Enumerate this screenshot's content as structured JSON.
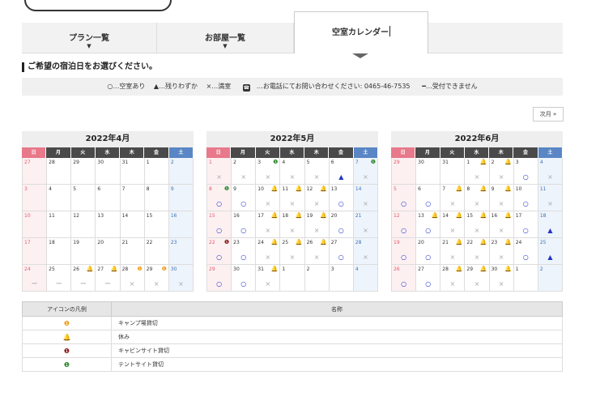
{
  "tabs": [
    {
      "label": "プラン一覧",
      "caret": "▼"
    },
    {
      "label": "お部屋一覧",
      "caret": "▼"
    },
    {
      "label": "空室カレンダー"
    }
  ],
  "heading": "ご希望の宿泊日をお選びください。",
  "legend_bar": {
    "available": "○…空室あり",
    "few": "▲…残りわずか",
    "full": "×…満室",
    "phone_icon": "☎",
    "phone": "…お電話にてお問い合わせください: 0465-46-7535",
    "closed": "━…受付できません"
  },
  "next_button": "次月 »",
  "weekdays": [
    "日",
    "月",
    "火",
    "水",
    "木",
    "金",
    "土"
  ],
  "calendars": [
    {
      "title": "2022年4月",
      "weeks": [
        [
          {
            "d": "27",
            "s": ""
          },
          {
            "d": "28",
            "s": ""
          },
          {
            "d": "29",
            "s": ""
          },
          {
            "d": "30",
            "s": ""
          },
          {
            "d": "31",
            "s": ""
          },
          {
            "d": "1",
            "s": ""
          },
          {
            "d": "2",
            "s": ""
          }
        ],
        [
          {
            "d": "3",
            "s": ""
          },
          {
            "d": "4",
            "s": ""
          },
          {
            "d": "5",
            "s": ""
          },
          {
            "d": "6",
            "s": ""
          },
          {
            "d": "7",
            "s": ""
          },
          {
            "d": "8",
            "s": ""
          },
          {
            "d": "9",
            "s": ""
          }
        ],
        [
          {
            "d": "10",
            "s": ""
          },
          {
            "d": "11",
            "s": ""
          },
          {
            "d": "12",
            "s": ""
          },
          {
            "d": "13",
            "s": ""
          },
          {
            "d": "14",
            "s": ""
          },
          {
            "d": "15",
            "s": ""
          },
          {
            "d": "16",
            "s": ""
          }
        ],
        [
          {
            "d": "17",
            "s": ""
          },
          {
            "d": "18",
            "s": ""
          },
          {
            "d": "19",
            "s": ""
          },
          {
            "d": "20",
            "s": ""
          },
          {
            "d": "21",
            "s": ""
          },
          {
            "d": "22",
            "s": ""
          },
          {
            "d": "23",
            "s": ""
          }
        ],
        [
          {
            "d": "24",
            "s": "ー"
          },
          {
            "d": "25",
            "s": "ー"
          },
          {
            "d": "26",
            "s": "ー",
            "i": "bell"
          },
          {
            "d": "27",
            "s": "ー",
            "i": "bell"
          },
          {
            "d": "28",
            "s": "×",
            "i": "camp"
          },
          {
            "d": "29",
            "s": "×",
            "i": "camp"
          },
          {
            "d": "30",
            "s": "×"
          }
        ]
      ]
    },
    {
      "title": "2022年5月",
      "weeks": [
        [
          {
            "d": "1",
            "s": "×"
          },
          {
            "d": "2",
            "s": "×"
          },
          {
            "d": "3",
            "s": "×",
            "i": "tent"
          },
          {
            "d": "4",
            "s": "×"
          },
          {
            "d": "5",
            "s": "×"
          },
          {
            "d": "6",
            "s": "▲"
          },
          {
            "d": "7",
            "s": "×",
            "i": "tent"
          }
        ],
        [
          {
            "d": "8",
            "s": "○",
            "i": "tent"
          },
          {
            "d": "9",
            "s": "○"
          },
          {
            "d": "10",
            "s": "×",
            "i": "bell"
          },
          {
            "d": "11",
            "s": "×",
            "i": "bell"
          },
          {
            "d": "12",
            "s": "×",
            "i": "bell"
          },
          {
            "d": "13",
            "s": "○"
          },
          {
            "d": "14",
            "s": "×"
          }
        ],
        [
          {
            "d": "15",
            "s": "○"
          },
          {
            "d": "16",
            "s": "○"
          },
          {
            "d": "17",
            "s": "×",
            "i": "bell"
          },
          {
            "d": "18",
            "s": "×",
            "i": "bell"
          },
          {
            "d": "19",
            "s": "×",
            "i": "bell"
          },
          {
            "d": "20",
            "s": "○"
          },
          {
            "d": "21",
            "s": "×"
          }
        ],
        [
          {
            "d": "22",
            "s": "○",
            "i": "cabin"
          },
          {
            "d": "23",
            "s": "○"
          },
          {
            "d": "24",
            "s": "×",
            "i": "bell"
          },
          {
            "d": "25",
            "s": "×",
            "i": "bell"
          },
          {
            "d": "26",
            "s": "×",
            "i": "bell"
          },
          {
            "d": "27",
            "s": "○"
          },
          {
            "d": "28",
            "s": "×"
          }
        ],
        [
          {
            "d": "29",
            "s": "○"
          },
          {
            "d": "30",
            "s": "○"
          },
          {
            "d": "31",
            "s": "×",
            "i": "bell"
          },
          {
            "d": "1",
            "s": ""
          },
          {
            "d": "2",
            "s": ""
          },
          {
            "d": "3",
            "s": ""
          },
          {
            "d": "4",
            "s": ""
          }
        ]
      ]
    },
    {
      "title": "2022年6月",
      "weeks": [
        [
          {
            "d": "29",
            "s": ""
          },
          {
            "d": "30",
            "s": ""
          },
          {
            "d": "31",
            "s": ""
          },
          {
            "d": "1",
            "s": "×",
            "i": "bell"
          },
          {
            "d": "2",
            "s": "×",
            "i": "bell"
          },
          {
            "d": "3",
            "s": "○"
          },
          {
            "d": "4",
            "s": "×"
          }
        ],
        [
          {
            "d": "5",
            "s": "○"
          },
          {
            "d": "6",
            "s": "○"
          },
          {
            "d": "7",
            "s": "×",
            "i": "bell"
          },
          {
            "d": "8",
            "s": "×",
            "i": "bell"
          },
          {
            "d": "9",
            "s": "×",
            "i": "bell"
          },
          {
            "d": "10",
            "s": "○"
          },
          {
            "d": "11",
            "s": "×"
          }
        ],
        [
          {
            "d": "12",
            "s": "○"
          },
          {
            "d": "13",
            "s": "○",
            "i": "bell"
          },
          {
            "d": "14",
            "s": "×",
            "i": "bell"
          },
          {
            "d": "15",
            "s": "×",
            "i": "bell"
          },
          {
            "d": "16",
            "s": "×",
            "i": "bell"
          },
          {
            "d": "17",
            "s": "○"
          },
          {
            "d": "18",
            "s": "▲"
          }
        ],
        [
          {
            "d": "19",
            "s": "○"
          },
          {
            "d": "20",
            "s": "○"
          },
          {
            "d": "21",
            "s": "×",
            "i": "bell"
          },
          {
            "d": "22",
            "s": "×",
            "i": "bell"
          },
          {
            "d": "23",
            "s": "×",
            "i": "bell"
          },
          {
            "d": "24",
            "s": "○"
          },
          {
            "d": "25",
            "s": "▲"
          }
        ],
        [
          {
            "d": "26",
            "s": "○"
          },
          {
            "d": "27",
            "s": "○"
          },
          {
            "d": "28",
            "s": "×",
            "i": "bell"
          },
          {
            "d": "29",
            "s": "×",
            "i": "bell"
          },
          {
            "d": "30",
            "s": "×",
            "i": "bell"
          },
          {
            "d": "1",
            "s": ""
          },
          {
            "d": "2",
            "s": ""
          }
        ]
      ]
    }
  ],
  "legend_table": {
    "header_icon": "アイコンの凡例",
    "header_name": "名称",
    "rows": [
      {
        "icon": "camp",
        "name": "キャンプ場貸切"
      },
      {
        "icon": "bell",
        "name": "休み"
      },
      {
        "icon": "cabin",
        "name": "キャビンサイト貸切"
      },
      {
        "icon": "tent",
        "name": "テントサイト貸切"
      }
    ]
  },
  "icon_glyphs": {
    "camp": {
      "glyph": "❶",
      "color": "#f0a020"
    },
    "bell": {
      "glyph": "🔔",
      "color": "#d9222a"
    },
    "cabin": {
      "glyph": "❶",
      "color": "#8b1a1a"
    },
    "tent": {
      "glyph": "❶",
      "color": "#2f8a2f"
    }
  }
}
